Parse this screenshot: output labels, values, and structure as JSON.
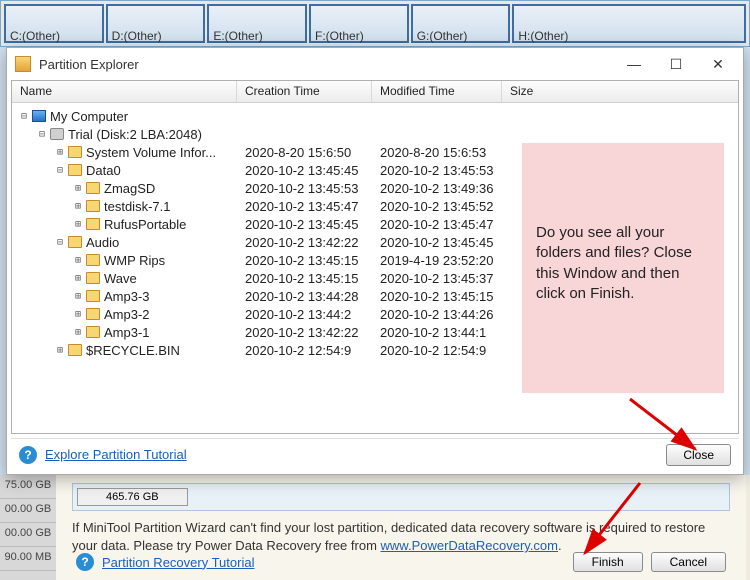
{
  "bg_parts": [
    "C:(Other)",
    "D:(Other)",
    "E:(Other)",
    "F:(Other)",
    "G:(Other)",
    "H:(Other)"
  ],
  "dialog": {
    "title": "Partition Explorer",
    "columns": {
      "name": "Name",
      "ct": "Creation Time",
      "mt": "Modified Time",
      "sz": "Size"
    },
    "tree": [
      {
        "depth": 0,
        "exp": "⊟",
        "icon": "pc",
        "label": "My Computer",
        "ct": "",
        "mt": ""
      },
      {
        "depth": 1,
        "exp": "⊟",
        "icon": "drive",
        "label": "Trial (Disk:2 LBA:2048)",
        "ct": "",
        "mt": ""
      },
      {
        "depth": 2,
        "exp": "⊞",
        "icon": "folder",
        "label": "System Volume Infor...",
        "ct": "2020-8-20 15:6:50",
        "mt": "2020-8-20 15:6:53"
      },
      {
        "depth": 2,
        "exp": "⊟",
        "icon": "folder",
        "label": "Data0",
        "ct": "2020-10-2 13:45:45",
        "mt": "2020-10-2 13:45:53"
      },
      {
        "depth": 3,
        "exp": "⊞",
        "icon": "folder",
        "label": "ZmagSD",
        "ct": "2020-10-2 13:45:53",
        "mt": "2020-10-2 13:49:36"
      },
      {
        "depth": 3,
        "exp": "⊞",
        "icon": "folder",
        "label": "testdisk-7.1",
        "ct": "2020-10-2 13:45:47",
        "mt": "2020-10-2 13:45:52"
      },
      {
        "depth": 3,
        "exp": "⊞",
        "icon": "folder",
        "label": "RufusPortable",
        "ct": "2020-10-2 13:45:45",
        "mt": "2020-10-2 13:45:47"
      },
      {
        "depth": 2,
        "exp": "⊟",
        "icon": "folder",
        "label": "Audio",
        "ct": "2020-10-2 13:42:22",
        "mt": "2020-10-2 13:45:45"
      },
      {
        "depth": 3,
        "exp": "⊞",
        "icon": "folder",
        "label": "WMP Rips",
        "ct": "2020-10-2 13:45:15",
        "mt": "2019-4-19 23:52:20"
      },
      {
        "depth": 3,
        "exp": "⊞",
        "icon": "folder",
        "label": "Wave",
        "ct": "2020-10-2 13:45:15",
        "mt": "2020-10-2 13:45:37"
      },
      {
        "depth": 3,
        "exp": "⊞",
        "icon": "folder",
        "label": "Amp3-3",
        "ct": "2020-10-2 13:44:28",
        "mt": "2020-10-2 13:45:15"
      },
      {
        "depth": 3,
        "exp": "⊞",
        "icon": "folder",
        "label": "Amp3-2",
        "ct": "2020-10-2 13:44:2",
        "mt": "2020-10-2 13:44:26"
      },
      {
        "depth": 3,
        "exp": "⊞",
        "icon": "folder",
        "label": "Amp3-1",
        "ct": "2020-10-2 13:42:22",
        "mt": "2020-10-2 13:44:1"
      },
      {
        "depth": 2,
        "exp": "⊞",
        "icon": "folder",
        "label": "$RECYCLE.BIN",
        "ct": "2020-10-2 12:54:9",
        "mt": "2020-10-2 12:54:9"
      }
    ],
    "footer_link": "Explore Partition Tutorial",
    "close_btn": "Close"
  },
  "note_text": "Do you see all your folders and files? Close this Window and then click on Finish.",
  "wizard": {
    "sidebar_sizes": [
      "75.00 GB",
      "00.00 GB",
      "00.00 GB",
      "90.00 MB"
    ],
    "disk_size": "465.76 GB",
    "msg_pre": "If MiniTool Partition Wizard can't find your lost partition, dedicated data recovery software is required to restore your data. Please try Power Data Recovery free from ",
    "msg_link_text": "www.PowerDataRecovery.com",
    "msg_post": ".",
    "tutorial_link": "Partition Recovery Tutorial",
    "finish_btn": "Finish",
    "cancel_btn": "Cancel"
  }
}
